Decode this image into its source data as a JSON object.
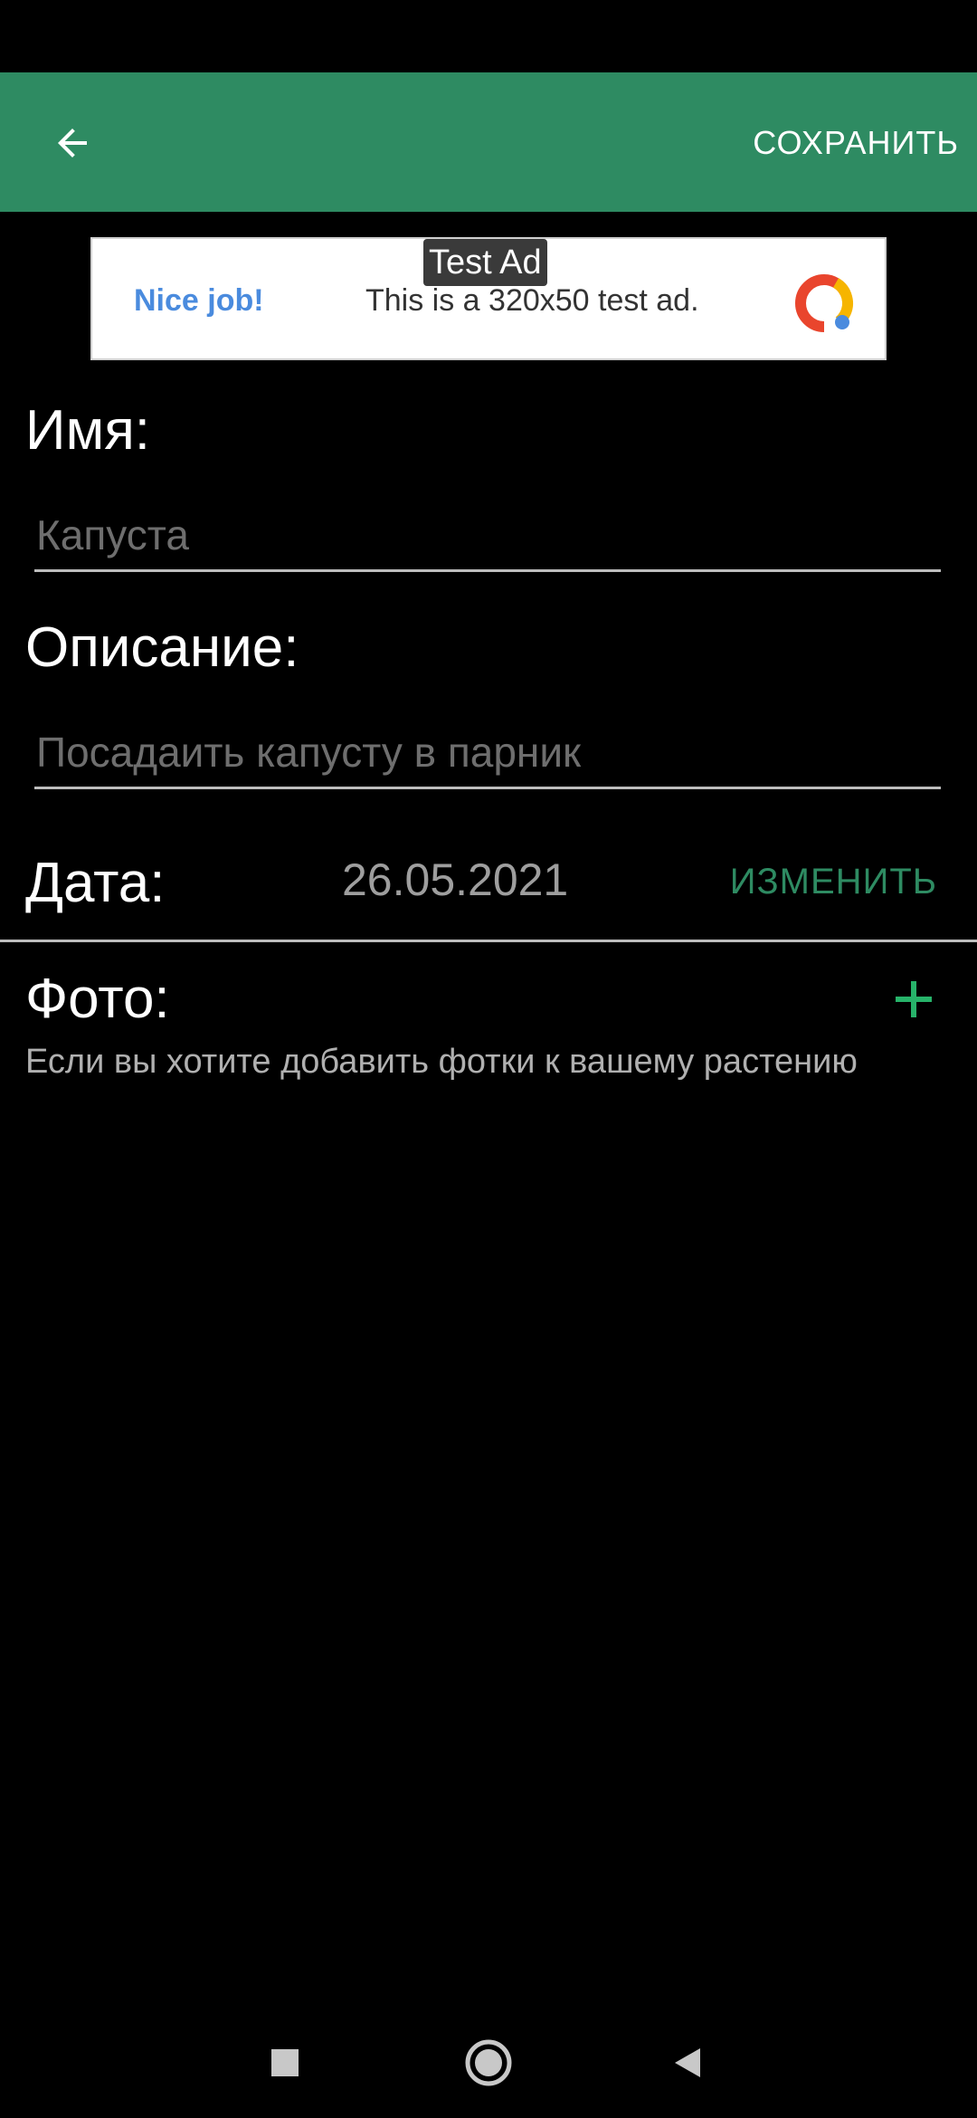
{
  "toolbar": {
    "save_label": "СОХРАНИТЬ",
    "back_icon": "arrow-back-icon",
    "color": "#2e8b62"
  },
  "ad": {
    "tag": "Test Ad",
    "left_text": "Nice job!",
    "text": "This is a 320x50 test ad.",
    "logo_icon": "ad-logo-icon"
  },
  "form": {
    "name_label": "Имя:",
    "name_placeholder": "Капуста",
    "description_label": "Описание:",
    "description_placeholder": "Посадаить капусту в парник",
    "date_label": "Дата:",
    "date_value": "26.05.2021",
    "change_label": "ИЗМЕНИТЬ",
    "photo_label": "Фото:",
    "photo_hint": "Если вы хотите добавить фотки к вашему растению"
  },
  "nav": {
    "recents_icon": "square-icon",
    "home_icon": "circle-icon",
    "back_icon": "triangle-back-icon"
  }
}
